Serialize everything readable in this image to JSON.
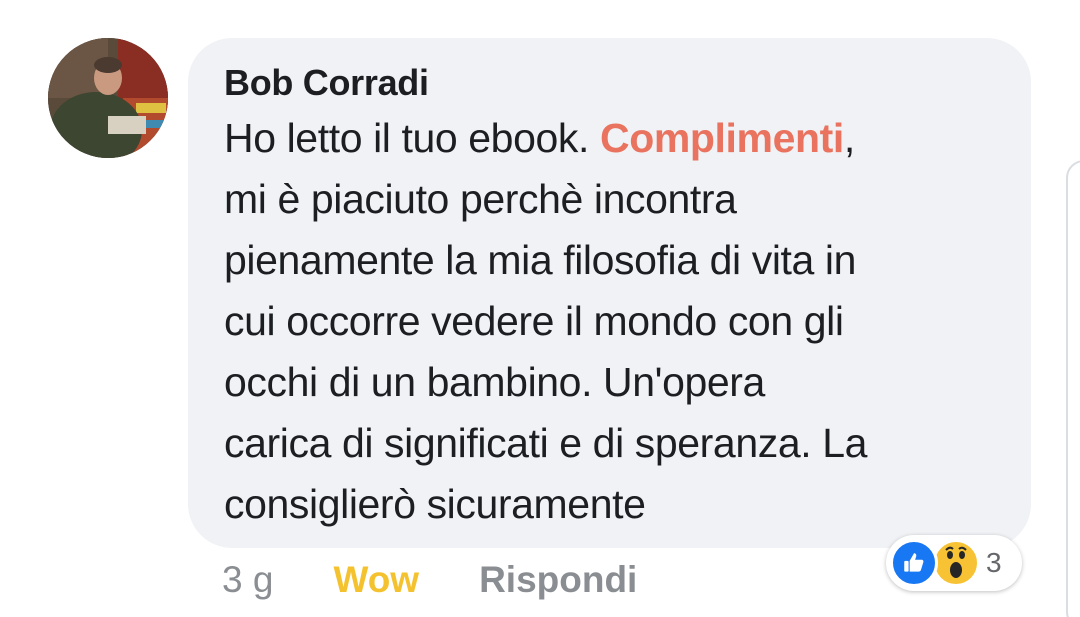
{
  "comment": {
    "author": "Bob Corradi",
    "text_lines": [
      {
        "before": "Ho letto il tuo ebook. ",
        "highlight": "Complimenti",
        "after": ","
      },
      "mi è piaciuto perchè incontra",
      "pienamente la mia filosofia di vita in",
      "cui occorre vedere il mondo con gli",
      "occhi di un bambino. Un'opera",
      "carica di significati e di speranza. La",
      "consiglierò sicuramente"
    ],
    "highlight_color": "#e9735e"
  },
  "actions": {
    "timestamp": "3 g",
    "reaction_label": "Wow",
    "reply_label": "Rispondi"
  },
  "reactions": {
    "icons": [
      "like-icon",
      "wow-icon"
    ],
    "count": "3"
  },
  "colors": {
    "bubble": "#f0f2f5",
    "like": "#1877f2",
    "wow": "#f7c234",
    "muted": "#8a8d91"
  }
}
